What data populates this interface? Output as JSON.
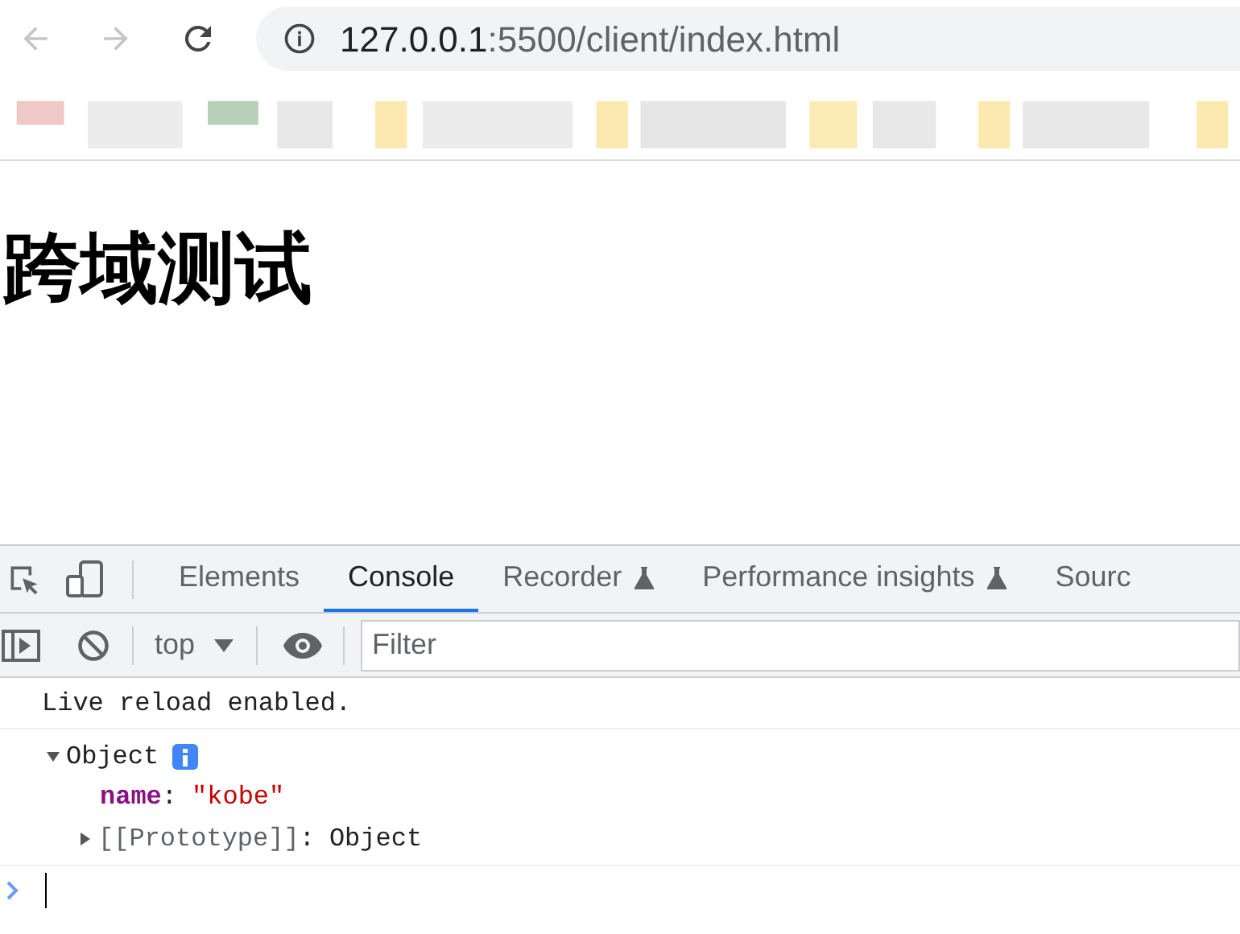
{
  "browser": {
    "url_host": "127.0.0.1",
    "url_path": ":5500/client/index.html"
  },
  "page": {
    "heading": "跨域测试"
  },
  "devtools": {
    "tabs": [
      {
        "label": "Elements",
        "selected": false,
        "experimental": false
      },
      {
        "label": "Console",
        "selected": true,
        "experimental": false
      },
      {
        "label": "Recorder",
        "selected": false,
        "experimental": true
      },
      {
        "label": "Performance insights",
        "selected": false,
        "experimental": true
      },
      {
        "label": "Sourc",
        "selected": false,
        "experimental": false
      }
    ],
    "context": "top",
    "filter": {
      "placeholder": "Filter"
    },
    "messages": [
      {
        "kind": "log",
        "text": "Live reload enabled."
      },
      {
        "kind": "object",
        "label": "Object",
        "expanded": true,
        "properties": [
          {
            "key": "name",
            "colon": ":",
            "value": "\"kobe\""
          }
        ],
        "prototype": {
          "label": "[[Prototype]]",
          "colon": ":",
          "value": "Object",
          "expanded": false
        }
      }
    ]
  }
}
